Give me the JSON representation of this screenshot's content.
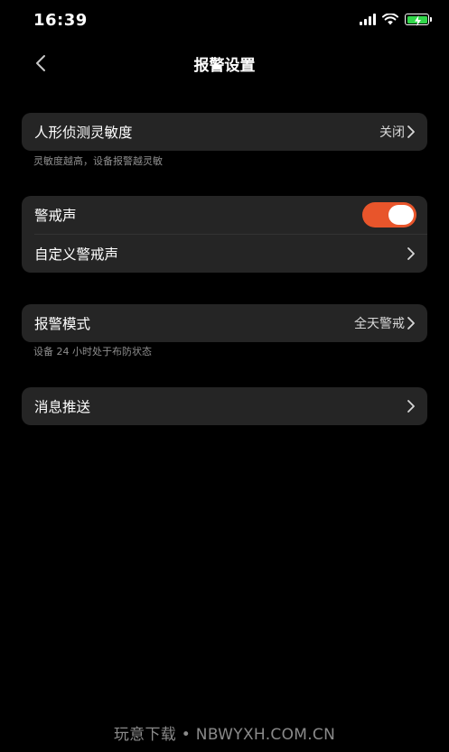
{
  "status_bar": {
    "time": "16:39",
    "icons": [
      "signal-icon",
      "wifi-icon",
      "battery-charging-icon"
    ],
    "battery_color": "#32d74b"
  },
  "nav": {
    "title": "报警设置",
    "back_icon": "chevron-left-icon"
  },
  "sections": {
    "sensitivity": {
      "label": "人形侦测灵敏度",
      "value": "关闭",
      "hint": "灵敏度越高，设备报警越灵敏"
    },
    "alarm_sound": {
      "toggle_label": "警戒声",
      "toggle_on": true,
      "custom_label": "自定义警戒声"
    },
    "alarm_mode": {
      "label": "报警模式",
      "value": "全天警戒",
      "hint": "设备 24 小时处于布防状态"
    },
    "push": {
      "label": "消息推送"
    }
  },
  "colors": {
    "background": "#000000",
    "card": "#252525",
    "accent": "#e8552b"
  },
  "watermark": "玩意下载 • NBWYXH.COM.CN"
}
